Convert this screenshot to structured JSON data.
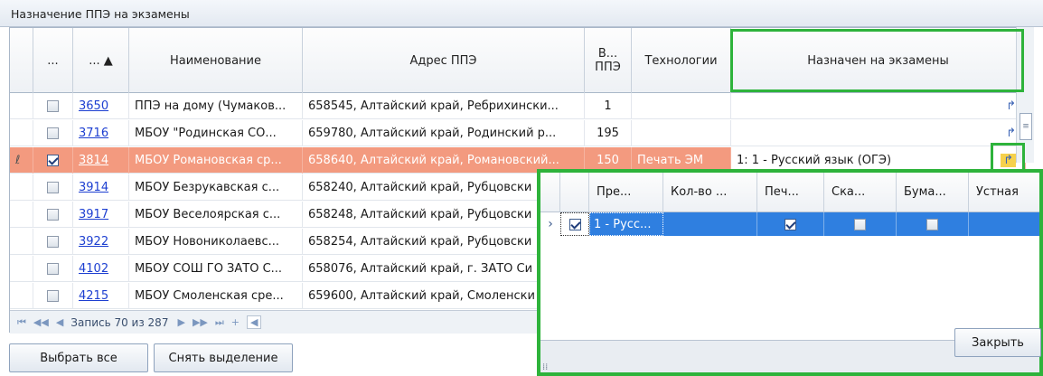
{
  "panel": {
    "title": "Назначение ППЭ на экзамены"
  },
  "columns": {
    "c1": "...",
    "c2": "... ▲",
    "name": "Наименование",
    "address": "Адрес ППЭ",
    "capacity": "В... ППЭ",
    "tech": "Технологии",
    "exams": "Назначен на экзамены"
  },
  "rows": [
    {
      "code": "3650",
      "name": "ППЭ на дому (Чумаков...",
      "address": "658545, Алтайский край, Ребрихински...",
      "capacity": "1",
      "tech": "",
      "exams": "",
      "checked": false
    },
    {
      "code": "3716",
      "name": "МБОУ \"Родинская СО...",
      "address": "659780, Алтайский край, Родинский р...",
      "capacity": "195",
      "tech": "",
      "exams": "",
      "checked": false
    },
    {
      "code": "3814",
      "name": "МБОУ Романовская ср...",
      "address": "658640, Алтайский край, Романовский...",
      "capacity": "150",
      "tech": "Печать ЭМ",
      "exams": "1: 1 - Русский язык (ОГЭ)",
      "checked": true
    },
    {
      "code": "3914",
      "name": "МБОУ Безрукавская с...",
      "address": "658240, Алтайский край, Рубцовски",
      "capacity": "",
      "tech": "",
      "exams": "",
      "checked": false
    },
    {
      "code": "3917",
      "name": "МБОУ Веселоярская с...",
      "address": "658248, Алтайский край, Рубцовски",
      "capacity": "",
      "tech": "",
      "exams": "",
      "checked": false
    },
    {
      "code": "3922",
      "name": "МБОУ Новониколаевс...",
      "address": "658254, Алтайский край, Рубцовски",
      "capacity": "",
      "tech": "",
      "exams": "",
      "checked": false
    },
    {
      "code": "4102",
      "name": "МБОУ СОШ ГО ЗАТО С...",
      "address": "658076, Алтайский край, г. ЗАТО Си",
      "capacity": "",
      "tech": "",
      "exams": "",
      "checked": false
    },
    {
      "code": "4215",
      "name": "МБОУ Смоленская сре...",
      "address": "659600, Алтайский край, Смоленски",
      "capacity": "",
      "tech": "",
      "exams": "",
      "checked": false
    }
  ],
  "pager": {
    "text": "Запись 70 из 287"
  },
  "buttons": {
    "select_all": "Выбрать все",
    "clear": "Снять выделение",
    "close": "Закрыть"
  },
  "popup": {
    "headers": [
      "Пре...",
      "Кол-во ...",
      "Печ...",
      "Ска...",
      "Бума...",
      "Устная"
    ],
    "row": {
      "subject": "1 - Русс...",
      "count": "",
      "print": true,
      "scan": false,
      "paper": false,
      "oral": ""
    }
  },
  "colors": {
    "selected_row": "#f39a7f",
    "popup_row": "#2f7fe0",
    "highlight": "#2eb33b"
  }
}
